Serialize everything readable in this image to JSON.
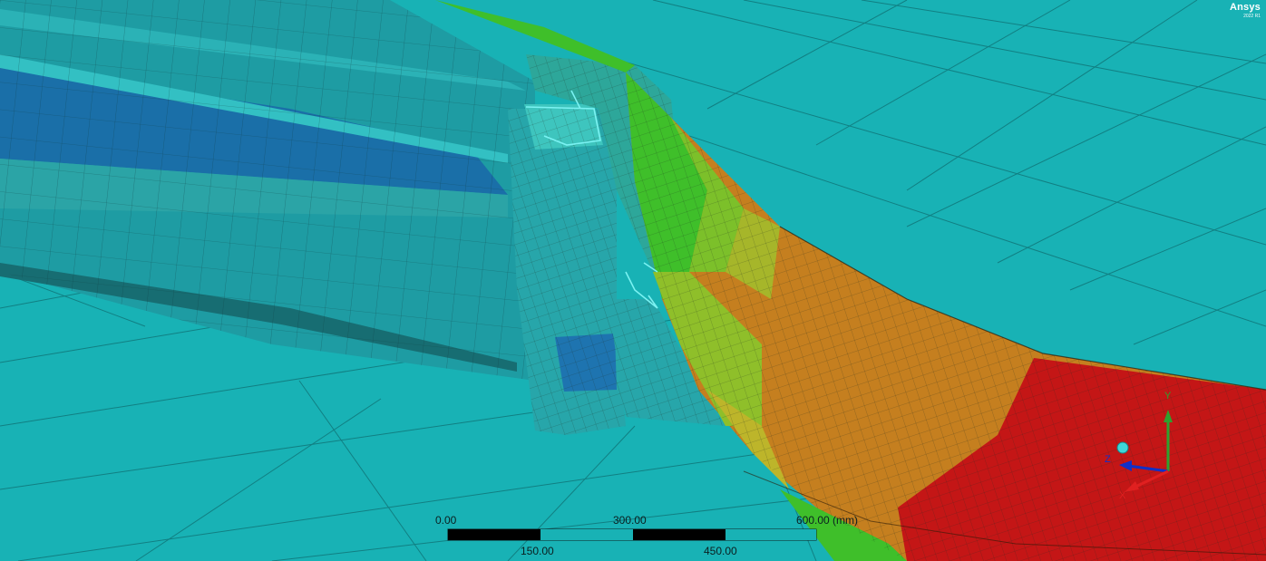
{
  "brand": {
    "name": "Ansys",
    "version": "2022 R1"
  },
  "scale_bar": {
    "top_labels": [
      "0.00",
      "300.00",
      "600.00 (mm)"
    ],
    "bottom_labels": [
      "150.00",
      "450.00"
    ]
  },
  "triad": {
    "x_label": "X",
    "y_label": "Y",
    "z_label": "Z"
  },
  "colors": {
    "background": "#18B2B5",
    "mesh_teal": "#1FA3A8",
    "mesh_blue": "#1E74B0",
    "contour_green": "#3FBF2A",
    "contour_yellow": "#BDB52A",
    "contour_orange": "#C57F1F",
    "contour_red": "#C41616",
    "axis_x": "#E02020",
    "axis_y": "#2EA12E",
    "axis_z": "#1030C8"
  }
}
